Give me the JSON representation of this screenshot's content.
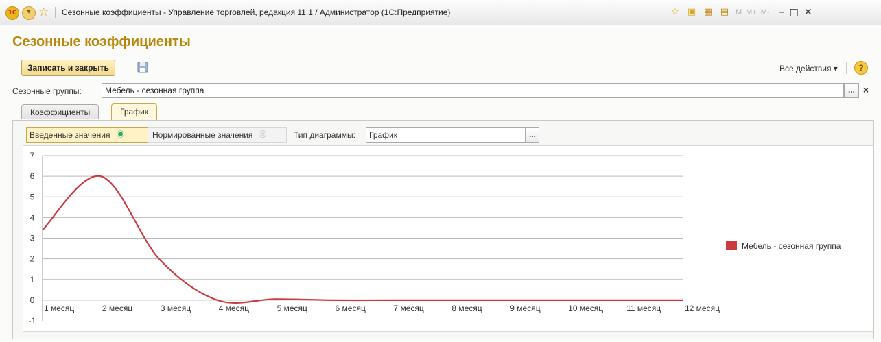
{
  "window": {
    "title": "Сезонные коэффициенты - Управление торговлей, редакция 11.1 / Администратор  (1С:Предприятие)",
    "logo": "1С",
    "toolbar_icons": [
      "favorite-add-icon",
      "bookmark-icon",
      "calculator-icon",
      "calendar-icon"
    ],
    "memory_buttons": [
      "M",
      "M+",
      "M-"
    ],
    "controls": [
      "minimize-icon",
      "maximize-icon",
      "close-icon"
    ]
  },
  "form": {
    "title": "Сезонные коэффициенты",
    "save_close_label": "Записать и закрыть",
    "all_actions_label": "Все действия ▾",
    "help_label": "?",
    "groups_label": "Сезонные группы:",
    "groups_value": "Мебель - сезонная группа",
    "select_button": "...",
    "clear_button": "×"
  },
  "tabs": [
    {
      "label": "Коэффициенты",
      "active": false
    },
    {
      "label": "График",
      "active": true
    }
  ],
  "chart_controls": {
    "entered_label": "Введенные значения",
    "normalized_label": "Нормированные значения",
    "selected": "entered",
    "type_label": "Тип диаграммы:",
    "type_value": "График",
    "type_button": "..."
  },
  "chart_data": {
    "type": "line",
    "categories": [
      "1 месяц",
      "2 месяц",
      "3 месяц",
      "4 месяц",
      "5 месяц",
      "6 месяц",
      "7 месяц",
      "8 месяц",
      "9 месяц",
      "10 месяц",
      "11 месяц",
      "12 месяц"
    ],
    "series": [
      {
        "name": "Мебель - сезонная группа",
        "color": "#cc3a3f",
        "values": [
          3.4,
          6,
          2,
          0,
          0.05,
          0,
          0,
          0,
          0,
          0,
          0,
          0
        ]
      }
    ],
    "y_ticks": [
      -1,
      0,
      1,
      2,
      3,
      4,
      5,
      6,
      7
    ],
    "ylim": [
      -1,
      7
    ],
    "grid": true,
    "smooth": true,
    "legend_position": "right"
  }
}
